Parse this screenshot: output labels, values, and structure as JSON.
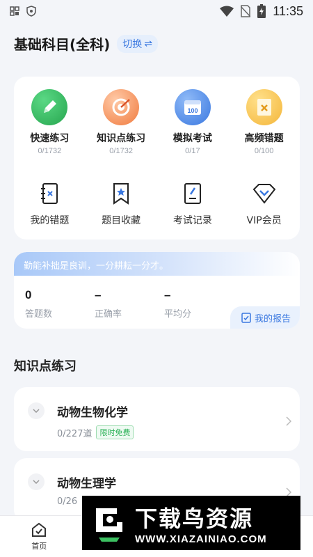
{
  "status_bar": {
    "time": "11:35"
  },
  "header": {
    "title": "基础科目(全科)",
    "switch_label": "切换"
  },
  "practice": [
    {
      "label": "快速练习",
      "count": "0/1732",
      "icon": "pencil-icon",
      "color": "#2fb35a"
    },
    {
      "label": "知识点练习",
      "count": "0/1732",
      "icon": "target-icon",
      "color": "#f07b3f"
    },
    {
      "label": "模拟考试",
      "count": "0/17",
      "icon": "calendar-icon",
      "color": "#3a78e0"
    },
    {
      "label": "高频错题",
      "count": "0/100",
      "icon": "wrong-doc-icon",
      "color": "#f4b63a"
    }
  ],
  "tools": [
    {
      "label": "我的错题",
      "icon": "mistake-book-icon"
    },
    {
      "label": "题目收藏",
      "icon": "bookmark-star-icon"
    },
    {
      "label": "考试记录",
      "icon": "exam-record-icon"
    },
    {
      "label": "VIP会员",
      "icon": "vip-diamond-icon"
    }
  ],
  "stats": {
    "motto": "勤能补拙是良训，一分耕耘一分才。",
    "answered_value": "0",
    "answered_label": "答题数",
    "accuracy_value": "–",
    "accuracy_label": "正确率",
    "average_value": "–",
    "average_label": "平均分",
    "report_label": "我的报告"
  },
  "section_title": "知识点练习",
  "subjects": [
    {
      "name": "动物生物化学",
      "progress": "0/227道",
      "badge": "限时免费"
    },
    {
      "name": "动物生理学",
      "progress": "0/26"
    }
  ],
  "nav": {
    "home": "首页"
  },
  "watermark": {
    "title": "下载鸟资源",
    "url": "WWW.XIAZAINIAO.COM"
  },
  "colors": {
    "accent": "#3a78e0",
    "background": "#f3f5f9",
    "free_badge": "#2fb35a"
  }
}
